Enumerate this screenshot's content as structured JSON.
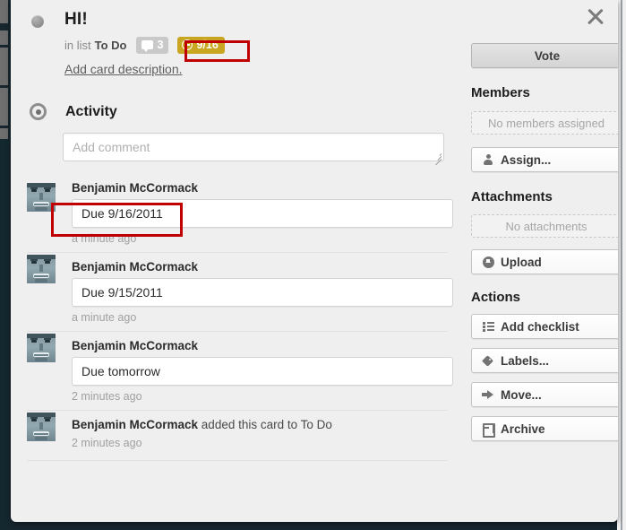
{
  "card": {
    "title": "HI!",
    "in_list_label": "in list",
    "list_name": "To Do",
    "comment_count": "3",
    "due_badge": "9/16",
    "due_badge_color": "#c8a622",
    "add_description_link": "Add card description."
  },
  "activity": {
    "heading": "Activity",
    "comment_placeholder": "Add comment",
    "items": [
      {
        "author": "Benjamin McCormack",
        "text": "Due 9/16/2011",
        "timestamp": "a minute ago",
        "type": "comment"
      },
      {
        "author": "Benjamin McCormack",
        "text": "Due 9/15/2011",
        "timestamp": "a minute ago",
        "type": "comment"
      },
      {
        "author": "Benjamin McCormack",
        "text": "Due tomorrow",
        "timestamp": "2 minutes ago",
        "type": "comment"
      },
      {
        "author": "Benjamin McCormack",
        "action": " added this card to To Do",
        "timestamp": "2 minutes ago",
        "type": "action"
      }
    ]
  },
  "sidebar": {
    "close_label": "close-icon",
    "vote_label": "Vote",
    "members_heading": "Members",
    "no_members_text": "No members assigned",
    "assign_label": "Assign...",
    "attachments_heading": "Attachments",
    "no_attachments_text": "No attachments",
    "upload_label": "Upload",
    "actions_heading": "Actions",
    "add_checklist_label": "Add checklist",
    "labels_label": "Labels...",
    "move_label": "Move...",
    "archive_label": "Archive"
  },
  "annotations": {
    "highlight_color": "#c00000",
    "boxes": [
      "due-date-badge",
      "latest-comment"
    ]
  }
}
